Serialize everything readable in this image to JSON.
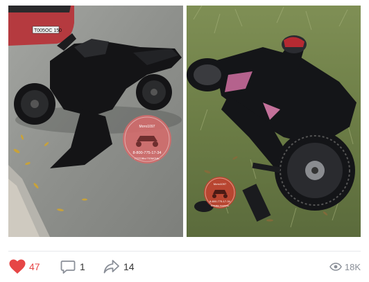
{
  "post": {
    "photos": [
      {
        "name": "photo-motorcycle-on-asphalt",
        "plate_text": "Т005ОС 150",
        "watermark": {
          "line1": "Мото1097",
          "line2": "8-800-775-17-34",
          "line3": "ГОТОВЫ ПОМОЧЬ"
        }
      },
      {
        "name": "photo-motorcycle-in-grass",
        "watermark": {
          "line1": "Мото1097",
          "line2": "8-800-775-17-34",
          "line3": "ГОТОВЫ ПОМОЧЬ"
        }
      }
    ]
  },
  "footer": {
    "likes": "47",
    "comments": "1",
    "shares": "14",
    "views": "18K",
    "like_color": "#e64646",
    "icon_color": "#8a8f98",
    "icons": {
      "like": "heart-icon",
      "comment": "comment-icon",
      "share": "share-arrow-icon",
      "views": "eye-icon"
    }
  }
}
